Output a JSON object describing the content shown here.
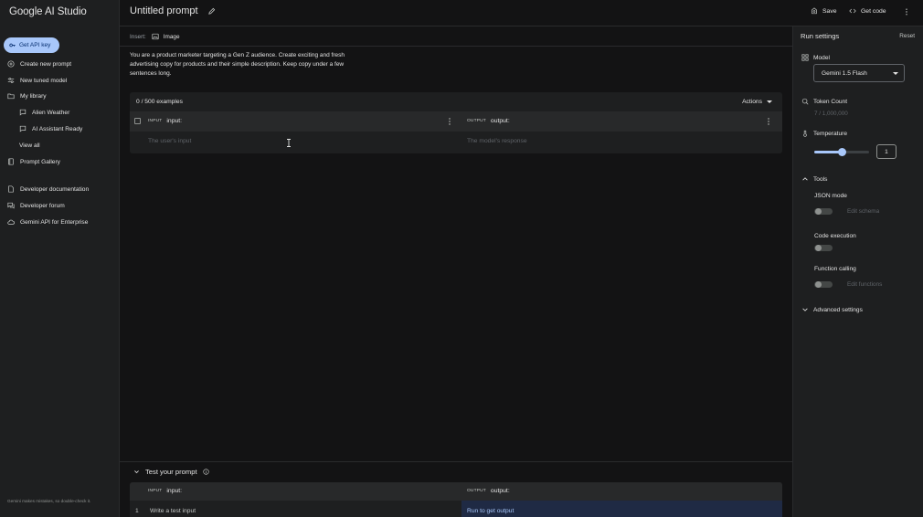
{
  "app": {
    "name": "Google AI Studio"
  },
  "sidebar": {
    "api_key_label": "Get API key",
    "items": [
      {
        "label": "Create new prompt",
        "icon": "plus-circle-icon"
      },
      {
        "label": "New tuned model",
        "icon": "tune-icon"
      },
      {
        "label": "My library",
        "icon": "folder-icon"
      },
      {
        "label": "Alien Weather",
        "icon": "chat-icon"
      },
      {
        "label": "AI Assistant Ready",
        "icon": "chat-icon"
      },
      {
        "label": "View all"
      },
      {
        "label": "Prompt Gallery",
        "icon": "book-icon"
      },
      {
        "label": "Developer documentation",
        "icon": "doc-icon"
      },
      {
        "label": "Developer forum",
        "icon": "forum-icon"
      },
      {
        "label": "Gemini API for Enterprise",
        "icon": "cloud-icon"
      }
    ],
    "footer": "Gemini makes mistakes, so double-check it."
  },
  "header": {
    "title": "Untitled prompt",
    "save_label": "Save",
    "get_code_label": "Get code"
  },
  "insert": {
    "label": "Insert:",
    "image_label": "Image"
  },
  "system_prompt": "You are a product marketer targeting a Gen Z audience. Create exciting and fresh advertising copy for products and their simple description. Keep copy under a few sentences long.",
  "examples": {
    "count_label": "0 / 500 examples",
    "actions_label": "Actions",
    "input_tag": "INPUT",
    "input_name": "input:",
    "output_tag": "OUTPUT",
    "output_name": "output:",
    "input_placeholder": "The user's input",
    "output_placeholder": "The model's response"
  },
  "test": {
    "title": "Test your prompt",
    "input_tag": "INPUT",
    "input_name": "input:",
    "output_tag": "OUTPUT",
    "output_name": "output:",
    "row_number": "1",
    "row_input": "Write a test input",
    "row_output": "Run to get output"
  },
  "run_settings": {
    "title": "Run settings",
    "reset_label": "Reset",
    "model_label": "Model",
    "model_value": "Gemini 1.5 Flash",
    "token_label": "Token Count",
    "token_value": "7 / 1,000,000",
    "temperature_label": "Temperature",
    "temperature_value": "1",
    "temperature_fraction": 0.5,
    "tools_label": "Tools",
    "json_mode_label": "JSON mode",
    "edit_schema_label": "Edit schema",
    "code_execution_label": "Code execution",
    "function_calling_label": "Function calling",
    "edit_functions_label": "Edit functions",
    "advanced_label": "Advanced settings"
  },
  "colors": {
    "accent": "#a8c7fa",
    "background": "#131314",
    "panel": "#1e1f20"
  }
}
